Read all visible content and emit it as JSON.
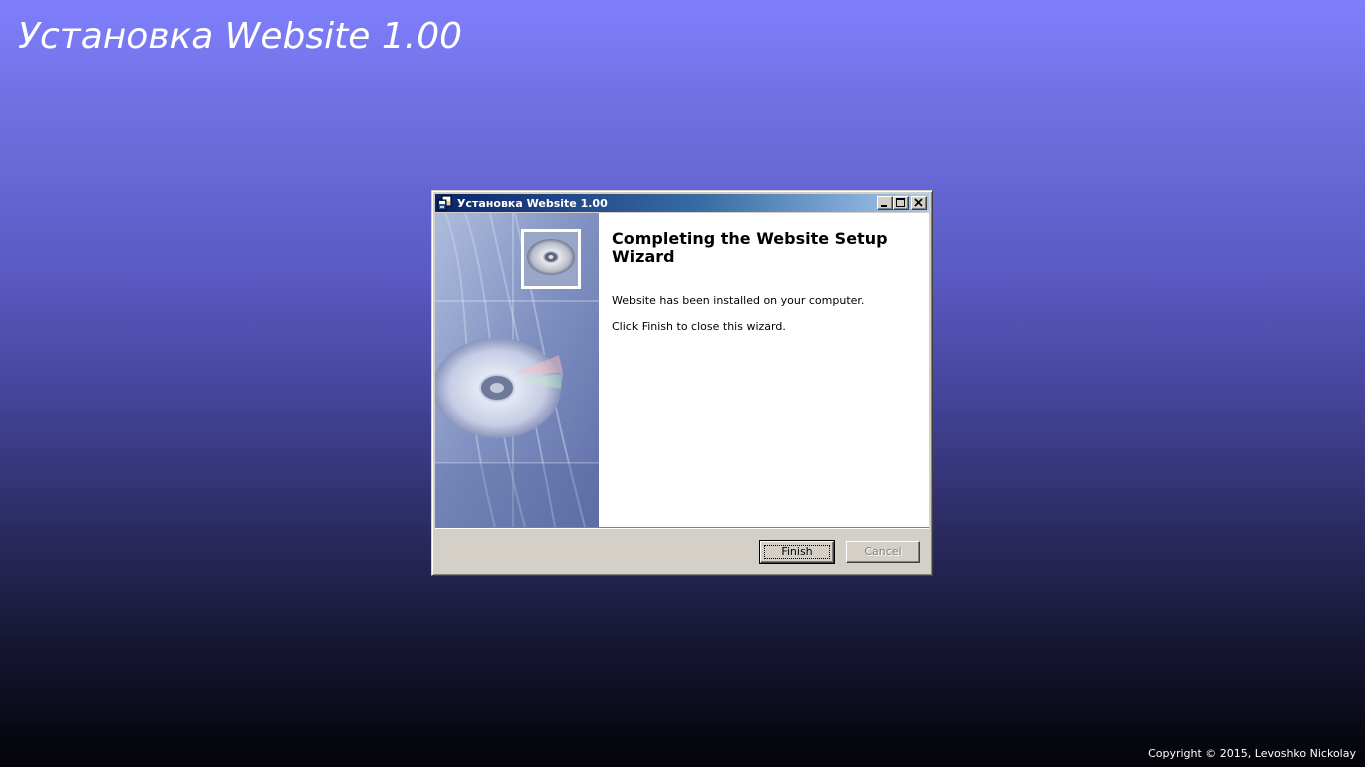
{
  "desktop": {
    "title": "Установка Website 1.00",
    "copyright": "Copyright © 2015, Levoshko Nickolay"
  },
  "window": {
    "title": "Установка Website 1.00",
    "icon": "installer-icon",
    "controls": {
      "minimize": "minimize-icon",
      "maximize": "maximize-icon",
      "close": "close-icon"
    }
  },
  "wizard": {
    "heading": "Completing the Website Setup Wizard",
    "line1": "Website has been installed on your computer.",
    "line2": "Click Finish to close this wizard.",
    "finish_label": "Finish",
    "cancel_label": "Cancel",
    "cancel_enabled": false
  },
  "colors": {
    "titlebar_start": "#0a246a",
    "titlebar_end": "#a6caf0",
    "desktop_top": "#7f7ffd",
    "desktop_bottom": "#030308",
    "dialog_face": "#d4d0c8"
  }
}
